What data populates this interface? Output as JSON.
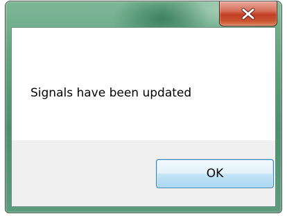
{
  "dialog": {
    "message": "Signals have been updated",
    "ok_label": "OK"
  },
  "titlebar": {
    "close_icon": "close-x-icon"
  },
  "colors": {
    "frame": "#5fa07d",
    "close_button": "#c23e24",
    "ok_button_border": "#3c7fb1",
    "button_area": "#f0f0f0"
  }
}
